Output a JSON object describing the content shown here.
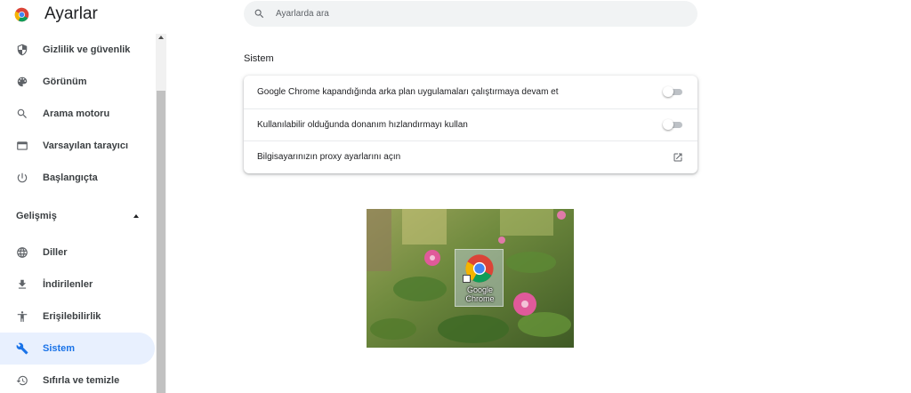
{
  "app": {
    "title": "Ayarlar"
  },
  "search": {
    "placeholder": "Ayarlarda ara"
  },
  "sidebar": {
    "items": [
      {
        "label": "Gizlilik ve güvenlik",
        "icon": "shield-icon"
      },
      {
        "label": "Görünüm",
        "icon": "palette-icon"
      },
      {
        "label": "Arama motoru",
        "icon": "search-icon"
      },
      {
        "label": "Varsayılan tarayıcı",
        "icon": "browser-icon"
      },
      {
        "label": "Başlangıçta",
        "icon": "power-icon"
      }
    ],
    "advanced_label": "Gelişmiş",
    "advanced_items": [
      {
        "label": "Diller",
        "icon": "globe-icon"
      },
      {
        "label": "İndirilenler",
        "icon": "download-icon"
      },
      {
        "label": "Erişilebilirlik",
        "icon": "accessibility-icon"
      },
      {
        "label": "Sistem",
        "icon": "wrench-icon",
        "active": true
      },
      {
        "label": "Sıfırla ve temizle",
        "icon": "history-icon"
      }
    ]
  },
  "main": {
    "section_title": "Sistem",
    "rows": [
      {
        "label": "Google Chrome kapandığında arka plan uygulamaları çalıştırmaya devam et",
        "control": "toggle",
        "enabled": false
      },
      {
        "label": "Kullanılabilir olduğunda donanım hızlandırmayı kullan",
        "control": "toggle",
        "enabled": false
      },
      {
        "label": "Bilgisayarınızın proxy ayarlarını açın",
        "control": "external-link-icon"
      }
    ]
  },
  "desktop": {
    "icon_label_line1": "Google",
    "icon_label_line2": "Chrome"
  },
  "colors": {
    "accent": "#1a73e8",
    "active_bg": "#e8f0fe",
    "text": "#202124"
  }
}
